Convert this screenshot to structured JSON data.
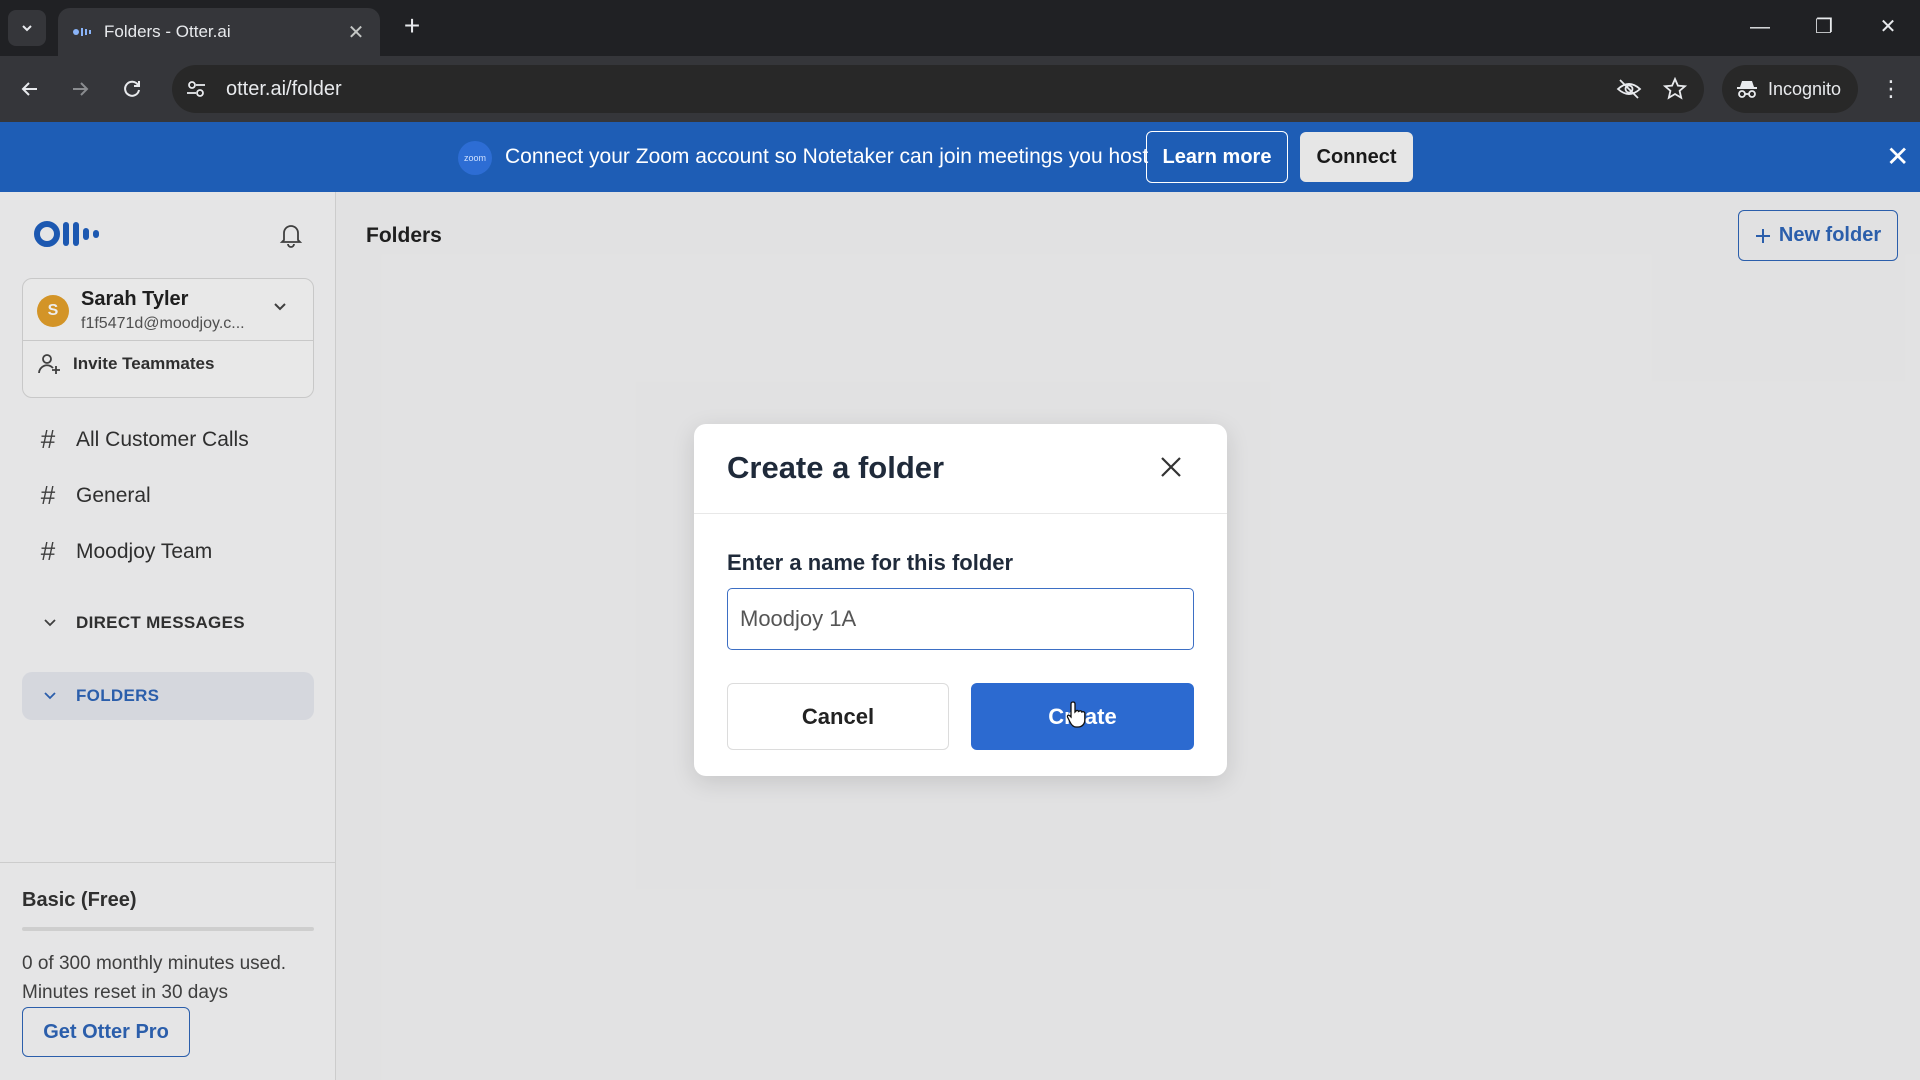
{
  "browser": {
    "tab_title": "Folders - Otter.ai",
    "url": "otter.ai/folder",
    "incognito_label": "Incognito"
  },
  "banner": {
    "zoom_badge": "zoom",
    "message": "Connect your Zoom account so Notetaker can join meetings you host",
    "learn_more": "Learn more",
    "connect": "Connect"
  },
  "sidebar": {
    "user": {
      "initial": "S",
      "name": "Sarah Tyler",
      "email": "f1f5471d@moodjoy.c..."
    },
    "invite_label": "Invite Teammates",
    "channels": [
      {
        "label": "All Customer Calls"
      },
      {
        "label": "General"
      },
      {
        "label": "Moodjoy Team"
      }
    ],
    "sections": {
      "direct_messages": "DIRECT MESSAGES",
      "folders": "FOLDERS"
    },
    "plan": {
      "name": "Basic (Free)",
      "usage_fraction": 0.0,
      "usage_line1": "0 of 300 monthly minutes used.",
      "usage_line2": "Minutes reset in 30 days",
      "upgrade_label": "Get Otter Pro"
    }
  },
  "main": {
    "title": "Folders",
    "new_folder_label": "New folder"
  },
  "modal": {
    "title": "Create a folder",
    "field_label": "Enter a name for this folder",
    "input_value": "Moodjoy 1A",
    "cancel_label": "Cancel",
    "create_label": "Create"
  },
  "colors": {
    "accent": "#2c6ad0",
    "banner": "#1e5db5",
    "avatar": "#e3a02a"
  }
}
